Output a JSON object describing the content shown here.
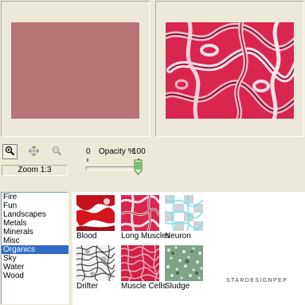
{
  "toolbar": {
    "zoom_label": "Zoom 1:3"
  },
  "opacity": {
    "min_label": "0",
    "label": "Opacity %",
    "max_label": "100",
    "value_percent": 100
  },
  "categories": [
    "Fire",
    "Fun",
    "Landscapes",
    "Metals",
    "Minerals",
    "Misc",
    "Organics",
    "Sky",
    "Water",
    "Wood"
  ],
  "selected_category": "Organics",
  "thumbnails": [
    {
      "label": "Blood"
    },
    {
      "label": "Long Muscles"
    },
    {
      "label": "Neuron"
    },
    {
      "label": "Drifter"
    },
    {
      "label": "Muscle Cells"
    },
    {
      "label": "Sludge"
    }
  ],
  "logo_text": "STARDESIGNPEP",
  "colors": {
    "preview_left": "#b87477",
    "selection": "#316ac5",
    "texture_red": "#d8264f"
  },
  "icons": [
    "zoom-in-icon",
    "pan-move-icon",
    "zoom-out-icon"
  ]
}
